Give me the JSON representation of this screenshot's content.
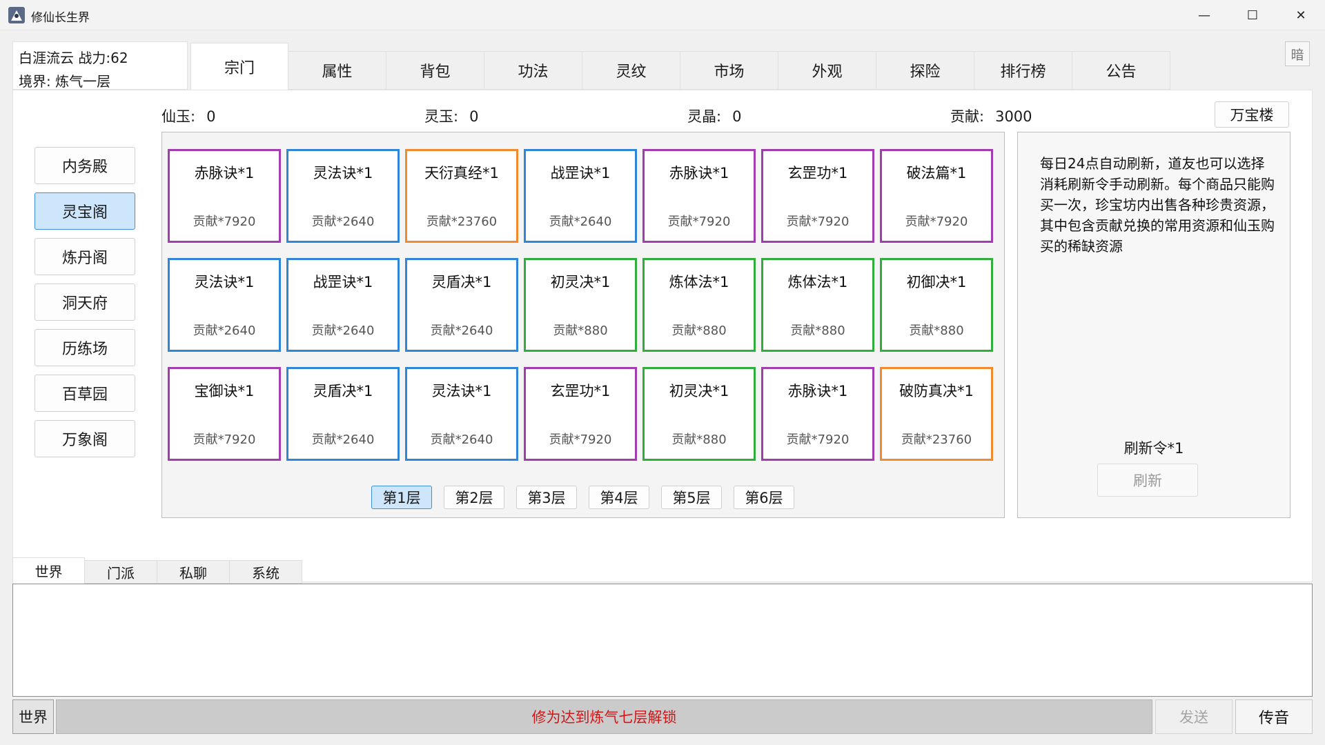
{
  "window": {
    "title": "修仙长生界",
    "minimize_glyph": "—",
    "maximize_glyph": "☐",
    "close_glyph": "✕"
  },
  "player": {
    "name_power": "白涯流云  战力:62",
    "realm": "境界: 炼气一层"
  },
  "tabs": [
    {
      "label": "宗门",
      "active": true
    },
    {
      "label": "属性"
    },
    {
      "label": "背包"
    },
    {
      "label": "功法"
    },
    {
      "label": "灵纹"
    },
    {
      "label": "市场"
    },
    {
      "label": "外观"
    },
    {
      "label": "探险"
    },
    {
      "label": "排行榜"
    },
    {
      "label": "公告"
    }
  ],
  "dark_toggle": "暗",
  "sidebar": [
    {
      "label": "内务殿"
    },
    {
      "label": "灵宝阁",
      "active": true
    },
    {
      "label": "炼丹阁"
    },
    {
      "label": "洞天府"
    },
    {
      "label": "历练场"
    },
    {
      "label": "百草园"
    },
    {
      "label": "万象阁"
    }
  ],
  "currencies": [
    {
      "label": "仙玉:",
      "value": "0"
    },
    {
      "label": "灵玉:",
      "value": "0"
    },
    {
      "label": "灵晶:",
      "value": "0"
    },
    {
      "label": "贡献:",
      "value": "3000"
    }
  ],
  "wanbao_button": "万宝楼",
  "rarity_colors": {
    "purple": "#a23db0",
    "blue": "#2f86d8",
    "orange": "#ef8a2e",
    "green": "#2fae3c"
  },
  "shop_items": [
    {
      "name": "赤脉诀*1",
      "price": "贡献*7920",
      "rarity": "purple"
    },
    {
      "name": "灵法诀*1",
      "price": "贡献*2640",
      "rarity": "blue"
    },
    {
      "name": "天衍真经*1",
      "price": "贡献*23760",
      "rarity": "orange"
    },
    {
      "name": "战罡诀*1",
      "price": "贡献*2640",
      "rarity": "blue"
    },
    {
      "name": "赤脉诀*1",
      "price": "贡献*7920",
      "rarity": "purple"
    },
    {
      "name": "玄罡功*1",
      "price": "贡献*7920",
      "rarity": "purple"
    },
    {
      "name": "破法篇*1",
      "price": "贡献*7920",
      "rarity": "purple"
    },
    {
      "name": "灵法诀*1",
      "price": "贡献*2640",
      "rarity": "blue"
    },
    {
      "name": "战罡诀*1",
      "price": "贡献*2640",
      "rarity": "blue"
    },
    {
      "name": "灵盾决*1",
      "price": "贡献*2640",
      "rarity": "blue"
    },
    {
      "name": "初灵决*1",
      "price": "贡献*880",
      "rarity": "green"
    },
    {
      "name": "炼体法*1",
      "price": "贡献*880",
      "rarity": "green"
    },
    {
      "name": "炼体法*1",
      "price": "贡献*880",
      "rarity": "green"
    },
    {
      "name": "初御决*1",
      "price": "贡献*880",
      "rarity": "green"
    },
    {
      "name": "宝御诀*1",
      "price": "贡献*7920",
      "rarity": "purple"
    },
    {
      "name": "灵盾决*1",
      "price": "贡献*2640",
      "rarity": "blue"
    },
    {
      "name": "灵法诀*1",
      "price": "贡献*2640",
      "rarity": "blue"
    },
    {
      "name": "玄罡功*1",
      "price": "贡献*7920",
      "rarity": "purple"
    },
    {
      "name": "初灵决*1",
      "price": "贡献*880",
      "rarity": "green"
    },
    {
      "name": "赤脉诀*1",
      "price": "贡献*7920",
      "rarity": "purple"
    },
    {
      "name": "破防真决*1",
      "price": "贡献*23760",
      "rarity": "orange"
    }
  ],
  "floors": [
    {
      "label": "第1层",
      "active": true
    },
    {
      "label": "第2层"
    },
    {
      "label": "第3层"
    },
    {
      "label": "第4层"
    },
    {
      "label": "第5层"
    },
    {
      "label": "第6层"
    }
  ],
  "info_text": "每日24点自动刷新，道友也可以选择消耗刷新令手动刷新。每个商品只能购买一次，珍宝坊内出售各种珍贵资源，其中包含贡献兑换的常用资源和仙玉购买的稀缺资源",
  "refresh_token": "刷新令*1",
  "refresh_button": "刷新",
  "chat_tabs": [
    {
      "label": "世界",
      "active": true
    },
    {
      "label": "门派"
    },
    {
      "label": "私聊"
    },
    {
      "label": "系统"
    }
  ],
  "bottom": {
    "channel": "世界",
    "locked_message": "修为达到炼气七层解锁",
    "send": "发送",
    "voice": "传音"
  }
}
